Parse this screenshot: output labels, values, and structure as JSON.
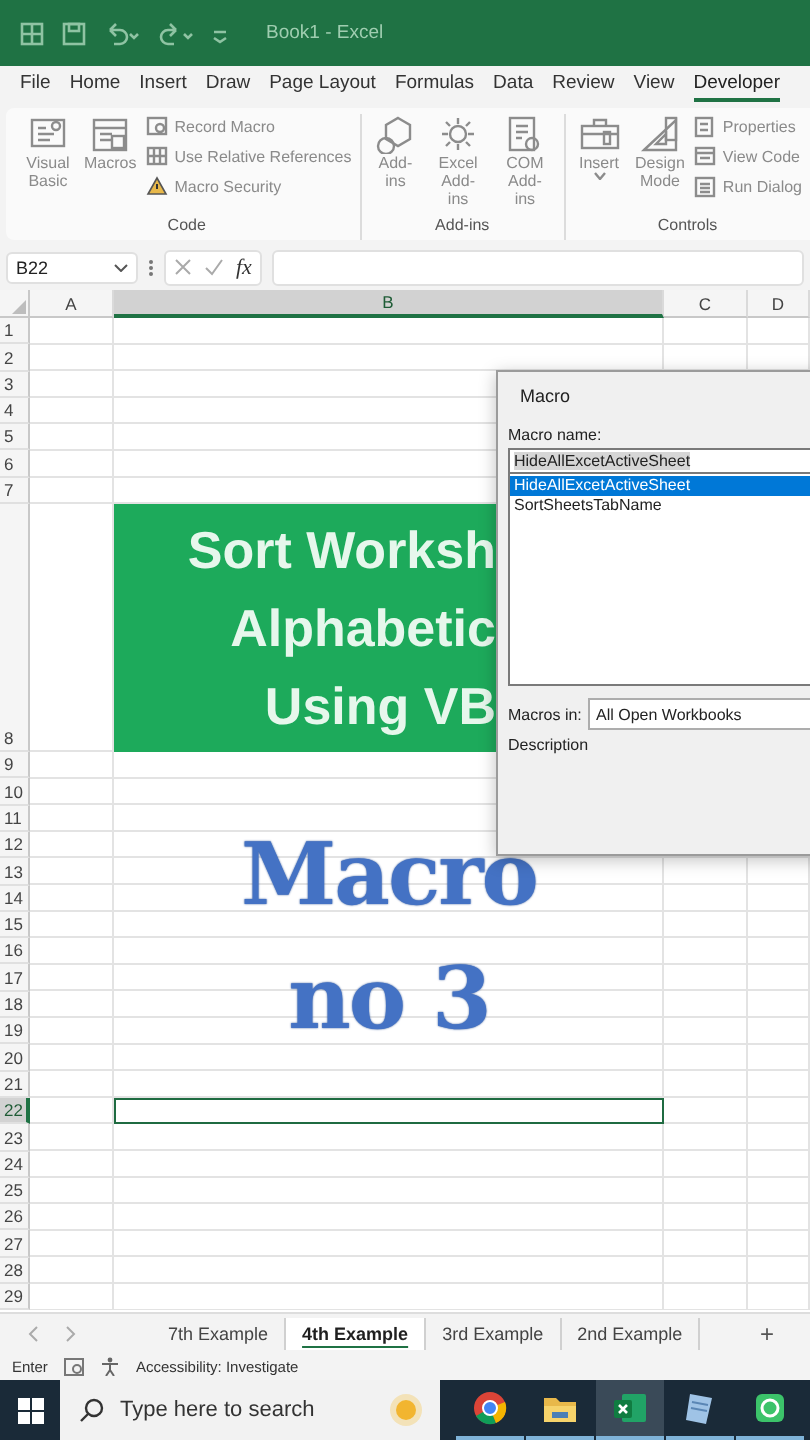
{
  "title_bar": {
    "title": "Book1 - Excel"
  },
  "ribbon_tabs": [
    {
      "label": "File",
      "selected": false
    },
    {
      "label": "Home",
      "selected": false
    },
    {
      "label": "Insert",
      "selected": false
    },
    {
      "label": "Draw",
      "selected": false
    },
    {
      "label": "Page Layout",
      "selected": false
    },
    {
      "label": "Formulas",
      "selected": false
    },
    {
      "label": "Data",
      "selected": false
    },
    {
      "label": "Review",
      "selected": false
    },
    {
      "label": "View",
      "selected": false
    },
    {
      "label": "Developer",
      "selected": true
    }
  ],
  "ribbon_groups": [
    {
      "label": "Code",
      "buttons": [
        {
          "kind": "large",
          "label": "Visual Basic",
          "dropdown": false
        },
        {
          "kind": "large",
          "label": "Macros",
          "dropdown": false
        },
        {
          "kind": "small",
          "label": "Record Macro",
          "dropdown": false
        },
        {
          "kind": "small",
          "label": "Use Relative References",
          "dropdown": false
        },
        {
          "kind": "small",
          "label": "Macro Security",
          "dropdown": false
        }
      ]
    },
    {
      "label": "Add-ins",
      "buttons": [
        {
          "kind": "large",
          "label": "Add-ins",
          "dropdown": false
        },
        {
          "kind": "large",
          "label": "Excel Add-ins",
          "dropdown": false
        },
        {
          "kind": "large",
          "label": "COM Add-ins",
          "dropdown": false
        }
      ]
    },
    {
      "label": "Controls",
      "buttons": [
        {
          "kind": "large",
          "label": "Insert",
          "dropdown": true
        },
        {
          "kind": "large",
          "label": "Design Mode",
          "dropdown": false
        },
        {
          "kind": "small",
          "label": "Properties",
          "dropdown": false
        },
        {
          "kind": "small",
          "label": "View Code",
          "dropdown": false
        },
        {
          "kind": "small",
          "label": "Run Dialog",
          "dropdown": false
        }
      ]
    }
  ],
  "formula_bar": {
    "name_box": "B22",
    "function_label": "fx"
  },
  "sheet": {
    "column_headers": [
      {
        "label": "A",
        "selected": false
      },
      {
        "label": "B",
        "selected": true
      },
      {
        "label": "C",
        "selected": false
      },
      {
        "label": "D",
        "selected": false
      }
    ],
    "row_headers": [
      {
        "label": "1",
        "selected": false
      },
      {
        "label": "2",
        "selected": false
      },
      {
        "label": "3",
        "selected": false
      },
      {
        "label": "4",
        "selected": false
      },
      {
        "label": "5",
        "selected": false
      },
      {
        "label": "6",
        "selected": false
      },
      {
        "label": "7",
        "selected": false
      },
      {
        "label": "8",
        "selected": false
      },
      {
        "label": "9",
        "selected": false
      },
      {
        "label": "10",
        "selected": false
      },
      {
        "label": "11",
        "selected": false
      },
      {
        "label": "12",
        "selected": false
      },
      {
        "label": "13",
        "selected": false
      },
      {
        "label": "14",
        "selected": false
      },
      {
        "label": "15",
        "selected": false
      },
      {
        "label": "16",
        "selected": false
      },
      {
        "label": "17",
        "selected": false
      },
      {
        "label": "18",
        "selected": false
      },
      {
        "label": "19",
        "selected": false
      },
      {
        "label": "20",
        "selected": false
      },
      {
        "label": "21",
        "selected": false
      },
      {
        "label": "22",
        "selected": true
      },
      {
        "label": "23",
        "selected": false
      },
      {
        "label": "24",
        "selected": false
      },
      {
        "label": "25",
        "selected": false
      },
      {
        "label": "26",
        "selected": false
      },
      {
        "label": "27",
        "selected": false
      },
      {
        "label": "28",
        "selected": false
      },
      {
        "label": "29",
        "selected": false
      }
    ],
    "banner": {
      "lines": [
        "Sort Worksh",
        "Alphabetic",
        "Using VB"
      ]
    },
    "title_art": {
      "lines": [
        "Macro",
        "no 3"
      ]
    }
  },
  "macro_dialog": {
    "title": "Macro",
    "name_label": "Macro name:",
    "name_value": "HideAllExcetActiveSheet",
    "macros": [
      {
        "name": "HideAllExcetActiveSheet",
        "selected": true
      },
      {
        "name": "SortSheetsTabName",
        "selected": false
      }
    ],
    "macros_in_label": "Macros in:",
    "macros_in_value": "All Open Workbooks",
    "description_label": "Description"
  },
  "sheet_tabs": [
    {
      "label": "7th Example",
      "selected": false
    },
    {
      "label": "4th Example",
      "selected": true
    },
    {
      "label": "3rd Example",
      "selected": false
    },
    {
      "label": "2nd Example",
      "selected": false
    }
  ],
  "add_sheet": "+",
  "status_bar": {
    "mode": "Enter",
    "accessibility": "Accessibility: Investigate"
  },
  "taskbar": {
    "search": {
      "placeholder": "Type here to search"
    },
    "apps": [
      {
        "selected": false
      },
      {
        "selected": false
      },
      {
        "selected": true
      },
      {
        "selected": false
      },
      {
        "selected": false
      }
    ]
  }
}
